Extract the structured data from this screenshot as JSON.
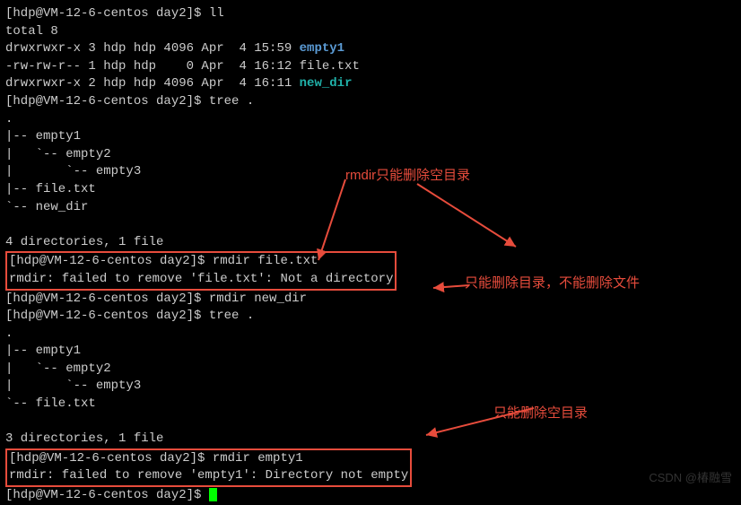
{
  "prompt": "[hdp@VM-12-6-centos day2]$ ",
  "cmd_ll": "ll",
  "ll_output": {
    "total": "total 8",
    "row1_perm": "drwxrwxr-x 3 hdp hdp 4096 Apr  4 15:59 ",
    "row1_name": "empty1",
    "row2_perm": "-rw-rw-r-- 1 hdp hdp    0 Apr  4 16:12 file.txt",
    "row3_perm": "drwxrwxr-x 2 hdp hdp 4096 Apr  4 16:11 ",
    "row3_name": "new_dir"
  },
  "cmd_tree1": "tree .",
  "tree1": {
    "dot": ".",
    "l1": "|-- empty1",
    "l2": "|   `-- empty2",
    "l3": "|       `-- empty3",
    "l4": "|-- file.txt",
    "l5": "`-- new_dir",
    "summary": "4 directories, 1 file"
  },
  "cmd_rmdir_file": "rmdir file.txt",
  "err_rmdir_file": "rmdir: failed to remove 'file.txt': Not a directory",
  "cmd_rmdir_newdir": "rmdir new_dir",
  "cmd_tree2": "tree .",
  "tree2": {
    "dot": ".",
    "l1": "|-- empty1",
    "l2": "|   `-- empty2",
    "l3": "|       `-- empty3",
    "l4": "`-- file.txt",
    "summary": "3 directories, 1 file"
  },
  "cmd_rmdir_empty1": "rmdir empty1",
  "err_rmdir_empty1": "rmdir: failed to remove 'empty1': Directory not empty",
  "annotations": {
    "a1": "rmdir只能删除空目录",
    "a2": "只能删除目录，不能删除文件",
    "a3": "只能删除空目录"
  },
  "watermark": "CSDN @椿融雪"
}
